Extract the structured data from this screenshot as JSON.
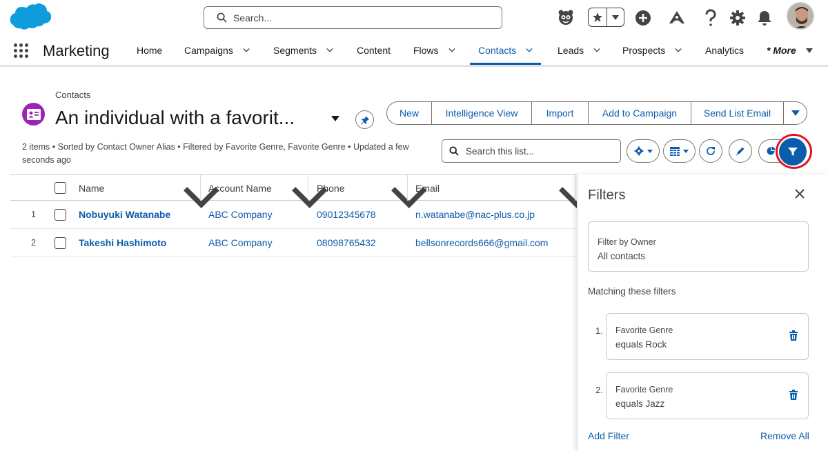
{
  "header": {
    "search_placeholder": "Search...",
    "icons": [
      "einstein-icon",
      "favorites-star-icon",
      "favorites-menu-icon",
      "add-icon",
      "trailhead-icon",
      "help-icon",
      "setup-gear-icon",
      "notifications-bell-icon",
      "user-avatar"
    ]
  },
  "nav": {
    "app_name": "Marketing",
    "items": [
      {
        "label": "Home",
        "dropdown": false
      },
      {
        "label": "Campaigns",
        "dropdown": true
      },
      {
        "label": "Segments",
        "dropdown": true
      },
      {
        "label": "Content",
        "dropdown": false
      },
      {
        "label": "Flows",
        "dropdown": true
      },
      {
        "label": "Contacts",
        "dropdown": true,
        "active": true
      },
      {
        "label": "Leads",
        "dropdown": true
      },
      {
        "label": "Prospects",
        "dropdown": true
      },
      {
        "label": "Analytics",
        "dropdown": false
      }
    ],
    "more_label": "* More"
  },
  "list_view": {
    "object_label": "Contacts",
    "title": "An individual with a favorit...",
    "meta": "2 items • Sorted by Contact Owner Alias • Filtered by Favorite Genre, Favorite Genre • Updated a few seconds ago",
    "actions": [
      "New",
      "Intelligence View",
      "Import",
      "Add to Campaign",
      "Send List Email"
    ],
    "search_placeholder": "Search this list..."
  },
  "table": {
    "columns": [
      "Name",
      "Account Name",
      "Phone",
      "Email"
    ],
    "rows": [
      {
        "num": "1",
        "name": "Nobuyuki Watanabe",
        "account": "ABC Company",
        "phone": "09012345678",
        "email": "n.watanabe@nac-plus.co.jp"
      },
      {
        "num": "2",
        "name": "Takeshi Hashimoto",
        "account": "ABC Company",
        "phone": "08098765432",
        "email": "bellsonrecords666@gmail.com"
      }
    ]
  },
  "filters": {
    "title": "Filters",
    "owner_label": "Filter by Owner",
    "owner_value": "All contacts",
    "matching_label": "Matching these filters",
    "items": [
      {
        "num": "1.",
        "field": "Favorite Genre",
        "condition": "equals Rock"
      },
      {
        "num": "2.",
        "field": "Favorite Genre",
        "condition": "equals Jazz"
      }
    ],
    "add_filter": "Add Filter",
    "remove_all": "Remove All"
  },
  "colors": {
    "brand": "#0b5cab",
    "object_icon": "#9c23b4",
    "highlight": "#e0141e",
    "cloud": "#0d9dda"
  }
}
